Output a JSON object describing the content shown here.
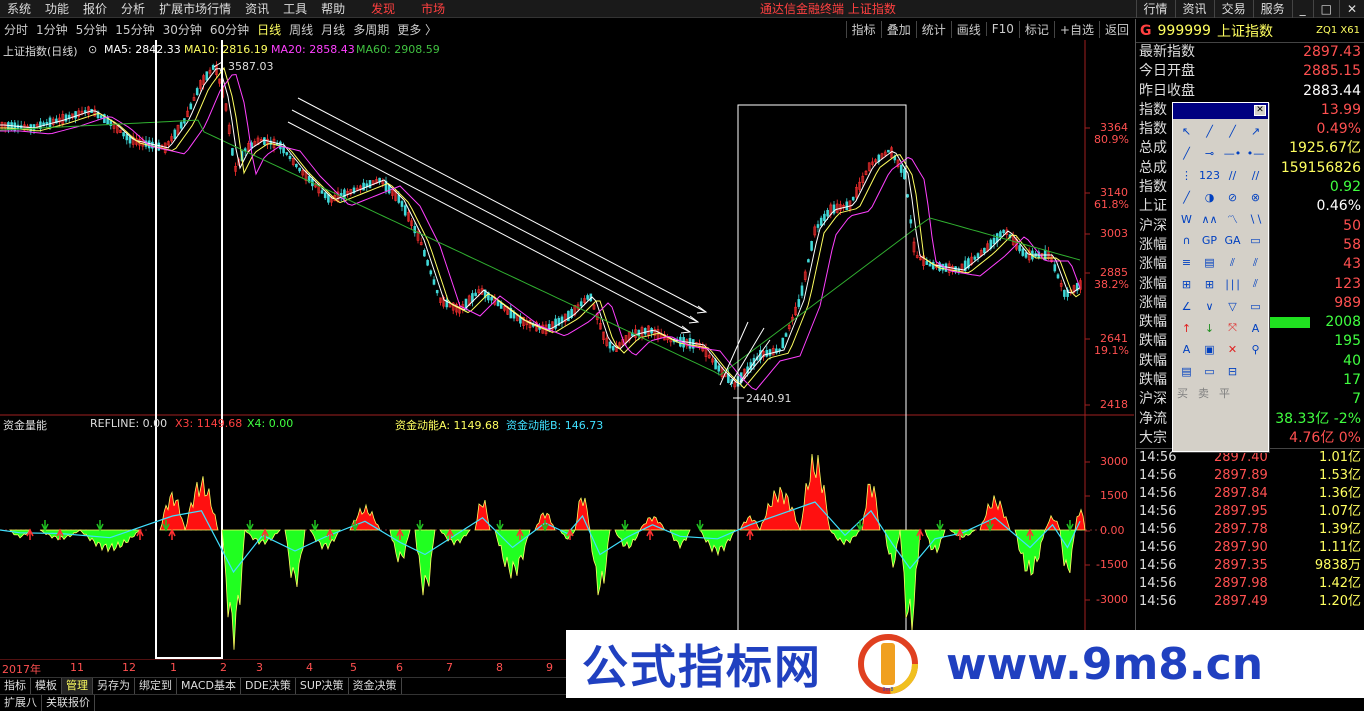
{
  "menubar": {
    "items": [
      "系统",
      "功能",
      "报价",
      "分析",
      "扩展市场行情",
      "资讯",
      "工具",
      "帮助"
    ],
    "highlight_items": [
      "发现",
      "市场"
    ],
    "terminal_title": "通达信金融终端 上证指数",
    "right_items": [
      "行情",
      "资讯",
      "交易",
      "服务"
    ]
  },
  "toolbar": {
    "periods": [
      "分时",
      "1分钟",
      "5分钟",
      "15分钟",
      "30分钟",
      "60分钟",
      "日线",
      "周线",
      "月线",
      "多周期",
      "更多 〉"
    ],
    "active_period": "日线",
    "right_items": [
      "指标",
      "叠加",
      "统计",
      "画线",
      "F10",
      "标记",
      "+自选",
      "返回"
    ]
  },
  "main_chart": {
    "title": "上证指数(日线)",
    "ma5": "MA5: 2842.33",
    "ma10": "MA10: 2816.19",
    "ma20": "MA20: 2858.43",
    "ma60": "MA60: 2908.59",
    "high_label": "3587.03",
    "low_label": "2440.91",
    "y_ticks": [
      "3364",
      "80.9%",
      "3140",
      "61.8%",
      "3003",
      "2885",
      "38.2%",
      "2641",
      "19.1%",
      "2418"
    ]
  },
  "sub_chart": {
    "title": "资金量能",
    "refline": "REFLINE: 0.00",
    "x3": "X3: 1149.68",
    "x4": "X4: 0.00",
    "flow_a": "资金动能A: 1149.68",
    "flow_b": "资金动能B: 146.73",
    "y_ticks": [
      "3000",
      "1500",
      "0.00",
      "-1500",
      "-3000"
    ]
  },
  "x_axis": [
    "2017年",
    "11",
    "12",
    "1",
    "2",
    "3",
    "4",
    "5",
    "6",
    "7",
    "8",
    "9"
  ],
  "bottom_tabs": [
    "指标",
    "模板",
    "管理",
    "另存为",
    "绑定到",
    "MACD基本",
    "DDE决策",
    "SUP决策",
    "资金决策"
  ],
  "bottom_active": "管理",
  "status": [
    "扩展八",
    "关联报价"
  ],
  "right_panel": {
    "marker": "G",
    "code": "999999",
    "name": "上证指数",
    "badge": "ZQ1 X61",
    "quote_rows": [
      {
        "k": "最新指数",
        "v": "2897.43",
        "c": "#ff5050"
      },
      {
        "k": "今日开盘",
        "v": "2885.15",
        "c": "#ff5050"
      },
      {
        "k": "昨日收盘",
        "v": "2883.44",
        "c": "#ffffff"
      },
      {
        "k": "指数",
        "v": "13.99",
        "c": "#ff5050"
      },
      {
        "k": "指数",
        "v": "0.49%",
        "c": "#ff5050"
      },
      {
        "k": "总成",
        "v": "1925.67亿",
        "c": "#ffff60"
      },
      {
        "k": "总成",
        "v": "159156826",
        "c": "#ffff60"
      },
      {
        "k": "指数",
        "v": "0.92",
        "c": "#40ff40"
      },
      {
        "k": "上证",
        "v": "0.46%",
        "c": "#ffffff"
      },
      {
        "k": "沪深",
        "v": "50",
        "c": "#ff5050"
      },
      {
        "k": "涨幅",
        "v": "58",
        "c": "#ff5050"
      },
      {
        "k": "涨幅",
        "v": "43",
        "c": "#ff5050"
      },
      {
        "k": "涨幅",
        "v": "123",
        "c": "#ff5050"
      },
      {
        "k": "涨幅",
        "v": "989",
        "c": "#ff5050"
      },
      {
        "k": "跌幅",
        "v": "2008",
        "c": "#40ff40"
      },
      {
        "k": "跌幅",
        "v": "195",
        "c": "#40ff40"
      },
      {
        "k": "跌幅",
        "v": "40",
        "c": "#40ff40"
      },
      {
        "k": "跌幅",
        "v": "17",
        "c": "#40ff40"
      },
      {
        "k": "沪深",
        "v": "7",
        "c": "#40ff40"
      },
      {
        "k": "净流",
        "v": "38.33亿  -2%",
        "c": "#40ff40"
      },
      {
        "k": "大宗",
        "v": "4.76亿   0%",
        "c": "#ff5050"
      }
    ],
    "up_down_bar": 0.3,
    "ticks": [
      {
        "t": "14:56",
        "p": "2897.40",
        "v": "1.01亿"
      },
      {
        "t": "14:56",
        "p": "2897.89",
        "v": "1.53亿"
      },
      {
        "t": "14:56",
        "p": "2897.84",
        "v": "1.36亿"
      },
      {
        "t": "14:56",
        "p": "2897.95",
        "v": "1.07亿"
      },
      {
        "t": "14:56",
        "p": "2897.78",
        "v": "1.39亿"
      },
      {
        "t": "14:56",
        "p": "2897.90",
        "v": "1.11亿"
      },
      {
        "t": "14:56",
        "p": "2897.35",
        "v": "9838万"
      },
      {
        "t": "14:56",
        "p": "2897.98",
        "v": "1.42亿"
      },
      {
        "t": "14:56",
        "p": "2897.49",
        "v": "1.20亿"
      }
    ]
  },
  "draw_panel": {
    "text_buttons": [
      "买",
      "卖",
      "平"
    ]
  },
  "watermark": {
    "cn": "公式指标网",
    "url": "www.9m8.cn",
    "logo_text": "9m8"
  },
  "colors": {
    "up": "#ff4040",
    "down": "#40ff40",
    "accent": "#ffff60",
    "ma5": "#ffffff",
    "ma10": "#ffff60",
    "ma20": "#ff40ff",
    "ma60": "#40c040"
  }
}
